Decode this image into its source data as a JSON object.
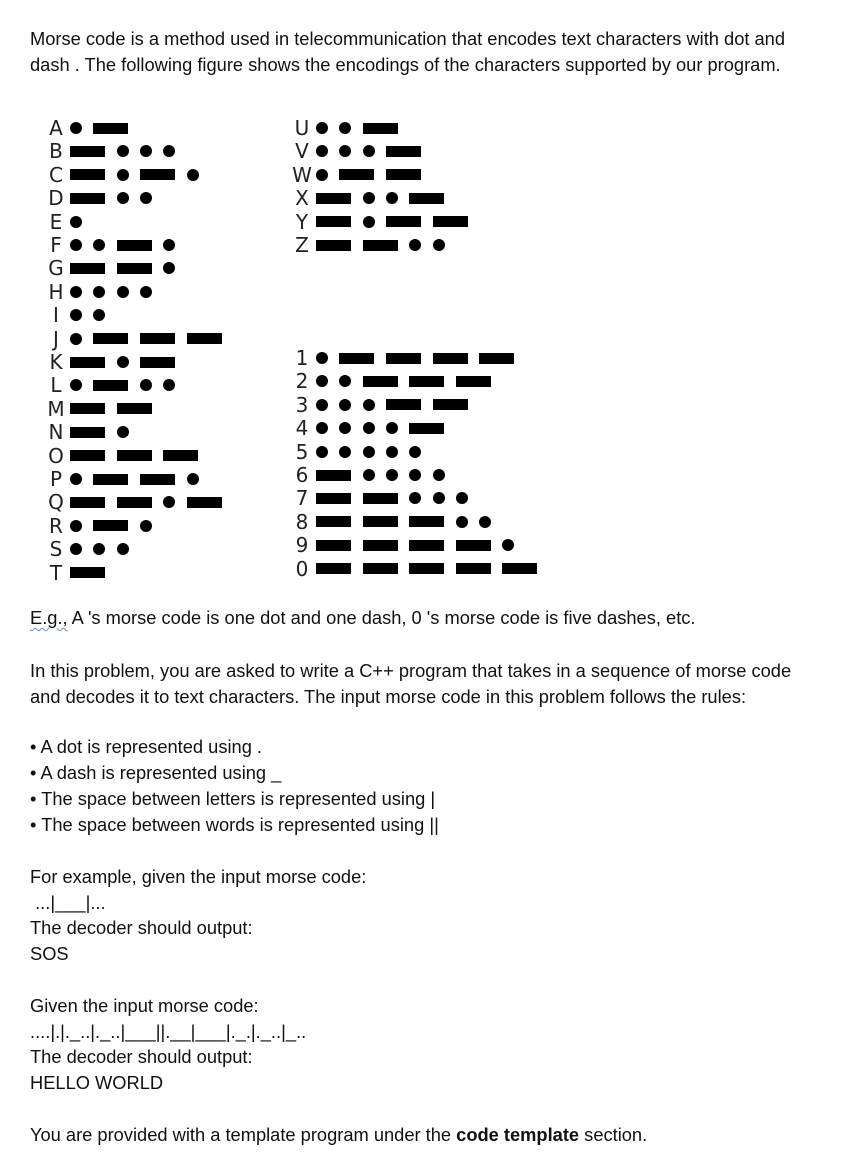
{
  "intro": "Morse code is a method used in telecommunication that encodes text characters with dot and dash . The following figure shows the encodings of the characters supported by our program.",
  "morse_figure": {
    "letters_left": [
      {
        "char": "A",
        "code": ".-"
      },
      {
        "char": "B",
        "code": "-..."
      },
      {
        "char": "C",
        "code": "-.-."
      },
      {
        "char": "D",
        "code": "-.."
      },
      {
        "char": "E",
        "code": "."
      },
      {
        "char": "F",
        "code": "..-."
      },
      {
        "char": "G",
        "code": "--."
      },
      {
        "char": "H",
        "code": "...."
      },
      {
        "char": "I",
        "code": ".."
      },
      {
        "char": "J",
        "code": ".---"
      },
      {
        "char": "K",
        "code": "-.-"
      },
      {
        "char": "L",
        "code": ".-.."
      },
      {
        "char": "M",
        "code": "--"
      },
      {
        "char": "N",
        "code": "-."
      },
      {
        "char": "O",
        "code": "---"
      },
      {
        "char": "P",
        "code": ".--."
      },
      {
        "char": "Q",
        "code": "--.-"
      },
      {
        "char": "R",
        "code": ".-."
      },
      {
        "char": "S",
        "code": "..."
      },
      {
        "char": "T",
        "code": "-"
      }
    ],
    "letters_right": [
      {
        "char": "U",
        "code": "..-"
      },
      {
        "char": "V",
        "code": "...-"
      },
      {
        "char": "W",
        "code": ".--"
      },
      {
        "char": "X",
        "code": "-..-"
      },
      {
        "char": "Y",
        "code": "-.--"
      },
      {
        "char": "Z",
        "code": "--.."
      }
    ],
    "digits": [
      {
        "char": "1",
        "code": ".----"
      },
      {
        "char": "2",
        "code": "..---"
      },
      {
        "char": "3",
        "code": "...--"
      },
      {
        "char": "4",
        "code": "....-"
      },
      {
        "char": "5",
        "code": "....."
      },
      {
        "char": "6",
        "code": "-...."
      },
      {
        "char": "7",
        "code": "--..."
      },
      {
        "char": "8",
        "code": "---.."
      },
      {
        "char": "9",
        "code": "----."
      },
      {
        "char": "0",
        "code": "-----"
      }
    ]
  },
  "example_note": {
    "prefix": "E.g.,",
    "rest": " A 's morse code is one dot and one dash, 0 's morse code is five dashes, etc."
  },
  "problem": "In this problem, you are asked to write a C++ program that takes in a sequence of morse code and decodes it to text characters. The input morse code in this problem follows the rules:",
  "rules": [
    "• A dot is represented using .",
    "• A dash is represented using _",
    "• The space between letters is represented using |",
    "• The space between words is represented using ||"
  ],
  "example1": {
    "intro": "For example, given the input morse code:",
    "input": " ...|___|...",
    "output_label": "The decoder should output:",
    "output": "SOS"
  },
  "example2": {
    "intro": "Given the input morse code:",
    "input": "....|.|._..|._..|___||.__|___|._.|._..|_..",
    "output_label": "The decoder should output:",
    "output": "HELLO WORLD"
  },
  "footer": {
    "prefix": "You are provided with a template program under the ",
    "bold": "code template",
    "suffix": " section."
  }
}
